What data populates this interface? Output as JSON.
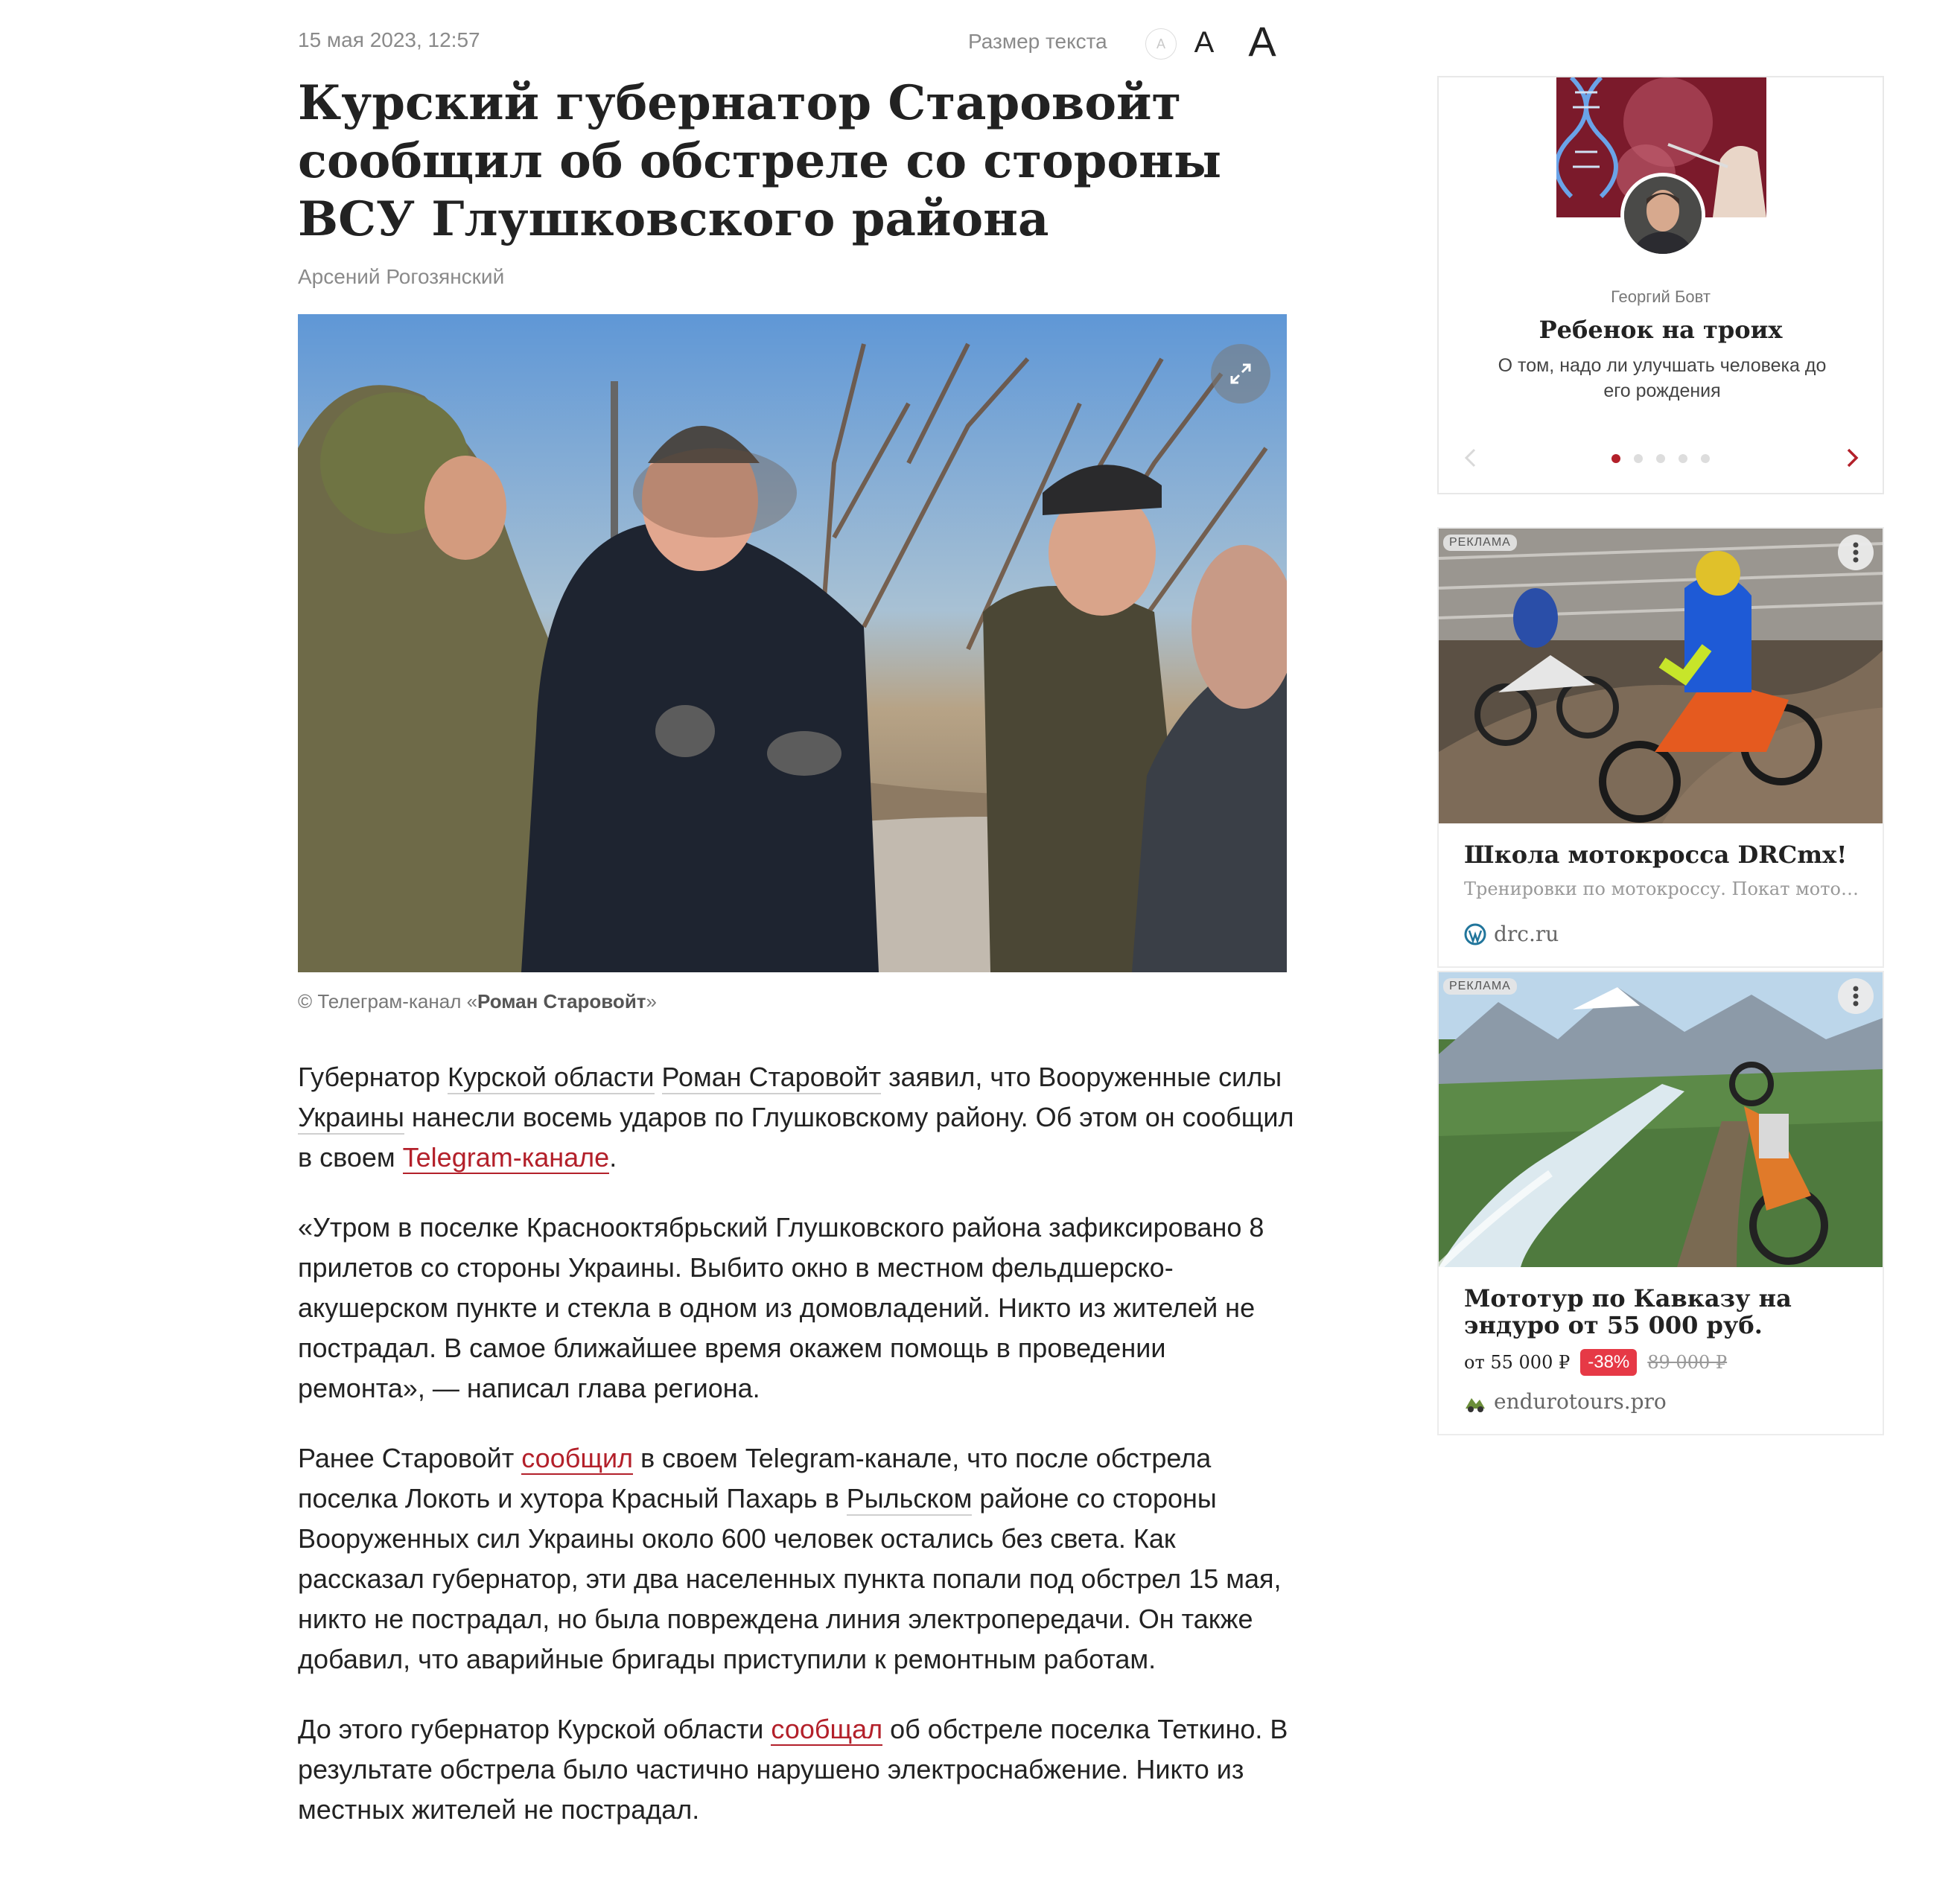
{
  "meta": {
    "date": "15 мая 2023, 12:57",
    "text_size_label": "Размер текста",
    "size_small": "A",
    "size_medium": "A",
    "size_large": "A"
  },
  "article": {
    "title": "Курский губернатор Старовойт сообщил об обстреле со стороны ВСУ Глушковского района",
    "author": "Арсений Рогозянский",
    "photo_caption_prefix": "©  Телеграм-канал «",
    "photo_caption_source": "Роман Старовойт",
    "photo_caption_suffix": "»",
    "p1": {
      "t1": "Губернатор ",
      "l1": "Курской области",
      "t2": " ",
      "l2": "Роман Старовойт",
      "t3": " заявил, что Вооруженные силы ",
      "l3": "Украины",
      "t4": " нанесли восемь ударов по Глушковскому району. Об этом он сообщил в своем ",
      "l4": "Telegram-канале",
      "t5": "."
    },
    "p2": "«Утром в поселке Краснооктябрьский Глушковского района зафиксировано 8 прилетов со стороны Украины. Выбито окно в местном фельдшерско-акушерском пункте и стекла в одном из домовладений. Никто из жителей не пострадал. В самое ближайшее время окажем помощь в проведении ремонта», — написал глава региона.",
    "p3": {
      "t1": "Ранее Старовойт ",
      "l1": "сообщил",
      "t2": " в своем Telegram-канале, что после обстрела поселка Локоть и хутора Красный Пахарь в ",
      "l2": "Рыльском",
      "t3": " районе со стороны Вооруженных сил Украины около 600 человек остались без света. Как рассказал губернатор, эти два населенных пункта попали под обстрел 15 мая, никто не пострадал, но была повреждена линия электропередачи. Он также добавил, что аварийные бригады приступили к ремонтным работам."
    },
    "p4": {
      "t1": "До этого губернатор Курской области ",
      "l1": "сообщал",
      "t2": " об обстреле поселка Теткино. В результате обстрела было частично нарушено электроснабжение. Никто из местных жителей не пострадал."
    }
  },
  "sidebar": {
    "opinion": {
      "author": "Георгий Бовт",
      "title": "Ребенок на троих",
      "subtitle": "О том, надо ли улучшать человека до его рождения",
      "slides": 5,
      "active_slide": 1
    },
    "ads": [
      {
        "badge": "РЕКЛАМА",
        "title": "Школа мотокросса DRCmx!",
        "description": "Тренировки по мотокроссу. Покат мотоцик...",
        "domain": "drc.ru"
      },
      {
        "badge": "РЕКЛАМА",
        "title": "Мототур по Кавказу на эндуро от 55 000 руб.",
        "price": "от 55 000 ₽",
        "discount": "-38%",
        "old_price": "89 000 ₽",
        "domain": "endurotours.pro"
      }
    ]
  },
  "colors": {
    "accent": "#b3202a",
    "discount": "#e63946",
    "muted_text": "#8a8a8a"
  },
  "icons": [
    "expand-icon",
    "chevron-left-icon",
    "chevron-right-icon",
    "more-vertical-icon",
    "wordpress-icon",
    "enduro-site-icon"
  ]
}
